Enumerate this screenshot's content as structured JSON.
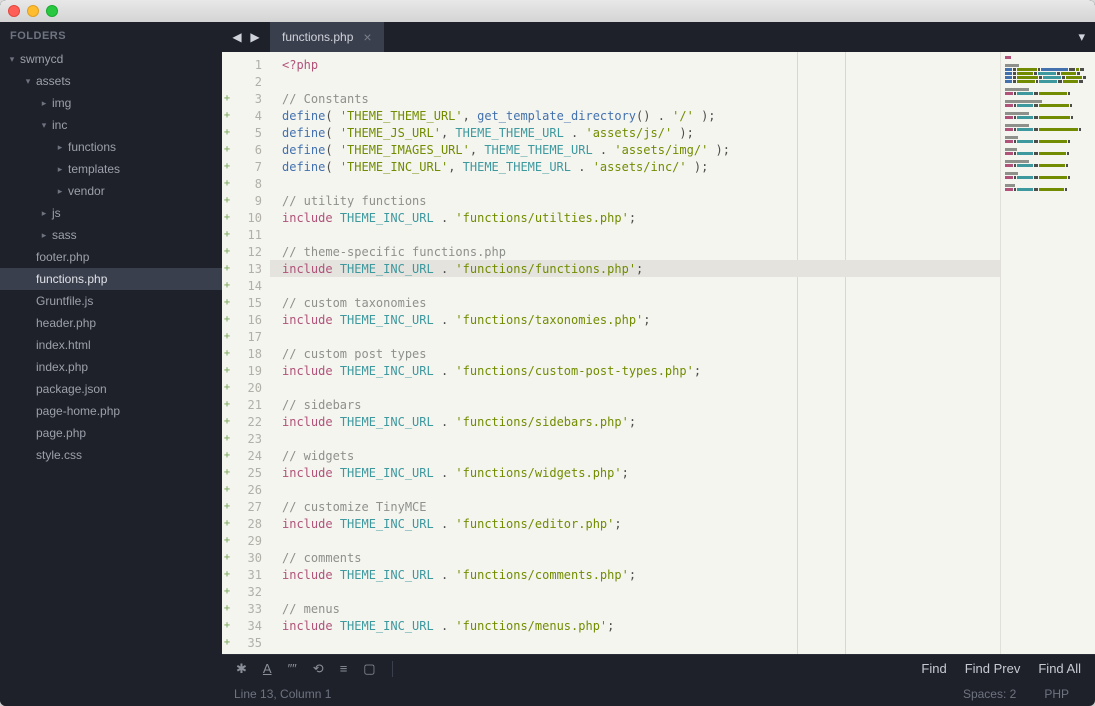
{
  "titlebar": {},
  "sidebar": {
    "header": "FOLDERS",
    "tree": [
      {
        "label": "swmycd",
        "depth": 0,
        "arrow": "down",
        "folder": true
      },
      {
        "label": "assets",
        "depth": 1,
        "arrow": "down",
        "folder": true
      },
      {
        "label": "img",
        "depth": 2,
        "arrow": "right",
        "folder": true
      },
      {
        "label": "inc",
        "depth": 2,
        "arrow": "down",
        "folder": true
      },
      {
        "label": "functions",
        "depth": 3,
        "arrow": "right",
        "folder": true
      },
      {
        "label": "templates",
        "depth": 3,
        "arrow": "right",
        "folder": true
      },
      {
        "label": "vendor",
        "depth": 3,
        "arrow": "right",
        "folder": true
      },
      {
        "label": "js",
        "depth": 2,
        "arrow": "right",
        "folder": true
      },
      {
        "label": "sass",
        "depth": 2,
        "arrow": "right",
        "folder": true
      },
      {
        "label": "footer.php",
        "depth": 1,
        "folder": false
      },
      {
        "label": "functions.php",
        "depth": 1,
        "folder": false,
        "active": true
      },
      {
        "label": "Gruntfile.js",
        "depth": 1,
        "folder": false
      },
      {
        "label": "header.php",
        "depth": 1,
        "folder": false
      },
      {
        "label": "index.html",
        "depth": 1,
        "folder": false
      },
      {
        "label": "index.php",
        "depth": 1,
        "folder": false
      },
      {
        "label": "package.json",
        "depth": 1,
        "folder": false
      },
      {
        "label": "page-home.php",
        "depth": 1,
        "folder": false
      },
      {
        "label": "page.php",
        "depth": 1,
        "folder": false
      },
      {
        "label": "style.css",
        "depth": 1,
        "folder": false
      }
    ]
  },
  "tabs": {
    "active": {
      "label": "functions.php"
    }
  },
  "code": {
    "lines": [
      {
        "n": 1,
        "plus": false,
        "selected": false,
        "tokens": [
          [
            "kw",
            "<?php"
          ]
        ]
      },
      {
        "n": 2,
        "plus": false,
        "selected": false,
        "tokens": []
      },
      {
        "n": 3,
        "plus": true,
        "selected": false,
        "tokens": [
          [
            "com",
            "// Constants"
          ]
        ]
      },
      {
        "n": 4,
        "plus": true,
        "selected": false,
        "tokens": [
          [
            "fn",
            "define"
          ],
          [
            "punc",
            "( "
          ],
          [
            "str",
            "'THEME_THEME_URL'"
          ],
          [
            "punc",
            ", "
          ],
          [
            "fn",
            "get_template_directory"
          ],
          [
            "punc",
            "() . "
          ],
          [
            "str",
            "'/'"
          ],
          [
            "punc",
            " );"
          ]
        ]
      },
      {
        "n": 5,
        "plus": true,
        "selected": false,
        "tokens": [
          [
            "fn",
            "define"
          ],
          [
            "punc",
            "( "
          ],
          [
            "str",
            "'THEME_JS_URL'"
          ],
          [
            "punc",
            ", "
          ],
          [
            "const",
            "THEME_THEME_URL"
          ],
          [
            "punc",
            " . "
          ],
          [
            "str",
            "'assets/js/'"
          ],
          [
            "punc",
            " );"
          ]
        ]
      },
      {
        "n": 6,
        "plus": true,
        "selected": false,
        "tokens": [
          [
            "fn",
            "define"
          ],
          [
            "punc",
            "( "
          ],
          [
            "str",
            "'THEME_IMAGES_URL'"
          ],
          [
            "punc",
            ", "
          ],
          [
            "const",
            "THEME_THEME_URL"
          ],
          [
            "punc",
            " . "
          ],
          [
            "str",
            "'assets/img/'"
          ],
          [
            "punc",
            " );"
          ]
        ]
      },
      {
        "n": 7,
        "plus": true,
        "selected": false,
        "tokens": [
          [
            "fn",
            "define"
          ],
          [
            "punc",
            "( "
          ],
          [
            "str",
            "'THEME_INC_URL'"
          ],
          [
            "punc",
            ", "
          ],
          [
            "const",
            "THEME_THEME_URL"
          ],
          [
            "punc",
            " . "
          ],
          [
            "str",
            "'assets/inc/'"
          ],
          [
            "punc",
            " );"
          ]
        ]
      },
      {
        "n": 8,
        "plus": true,
        "selected": false,
        "tokens": []
      },
      {
        "n": 9,
        "plus": true,
        "selected": false,
        "tokens": [
          [
            "com",
            "// utility functions"
          ]
        ]
      },
      {
        "n": 10,
        "plus": true,
        "selected": false,
        "tokens": [
          [
            "kw",
            "include"
          ],
          [
            "punc",
            " "
          ],
          [
            "const",
            "THEME_INC_URL"
          ],
          [
            "punc",
            " . "
          ],
          [
            "str",
            "'functions/utilties.php'"
          ],
          [
            "punc",
            ";"
          ]
        ]
      },
      {
        "n": 11,
        "plus": true,
        "selected": false,
        "tokens": []
      },
      {
        "n": 12,
        "plus": true,
        "selected": false,
        "tokens": [
          [
            "com",
            "// theme-specific functions.php"
          ]
        ]
      },
      {
        "n": 13,
        "plus": true,
        "selected": true,
        "tokens": [
          [
            "kw",
            "include"
          ],
          [
            "punc",
            " "
          ],
          [
            "const",
            "THEME_INC_URL"
          ],
          [
            "punc",
            " . "
          ],
          [
            "str",
            "'functions/functions.php'"
          ],
          [
            "punc",
            ";"
          ]
        ]
      },
      {
        "n": 14,
        "plus": true,
        "selected": false,
        "tokens": []
      },
      {
        "n": 15,
        "plus": true,
        "selected": false,
        "tokens": [
          [
            "com",
            "// custom taxonomies"
          ]
        ]
      },
      {
        "n": 16,
        "plus": true,
        "selected": false,
        "tokens": [
          [
            "kw",
            "include"
          ],
          [
            "punc",
            " "
          ],
          [
            "const",
            "THEME_INC_URL"
          ],
          [
            "punc",
            " . "
          ],
          [
            "str",
            "'functions/taxonomies.php'"
          ],
          [
            "punc",
            ";"
          ]
        ]
      },
      {
        "n": 17,
        "plus": true,
        "selected": false,
        "tokens": []
      },
      {
        "n": 18,
        "plus": true,
        "selected": false,
        "tokens": [
          [
            "com",
            "// custom post types"
          ]
        ]
      },
      {
        "n": 19,
        "plus": true,
        "selected": false,
        "tokens": [
          [
            "kw",
            "include"
          ],
          [
            "punc",
            " "
          ],
          [
            "const",
            "THEME_INC_URL"
          ],
          [
            "punc",
            " . "
          ],
          [
            "str",
            "'functions/custom-post-types.php'"
          ],
          [
            "punc",
            ";"
          ]
        ]
      },
      {
        "n": 20,
        "plus": true,
        "selected": false,
        "tokens": []
      },
      {
        "n": 21,
        "plus": true,
        "selected": false,
        "tokens": [
          [
            "com",
            "// sidebars"
          ]
        ]
      },
      {
        "n": 22,
        "plus": true,
        "selected": false,
        "tokens": [
          [
            "kw",
            "include"
          ],
          [
            "punc",
            " "
          ],
          [
            "const",
            "THEME_INC_URL"
          ],
          [
            "punc",
            " . "
          ],
          [
            "str",
            "'functions/sidebars.php'"
          ],
          [
            "punc",
            ";"
          ]
        ]
      },
      {
        "n": 23,
        "plus": true,
        "selected": false,
        "tokens": []
      },
      {
        "n": 24,
        "plus": true,
        "selected": false,
        "tokens": [
          [
            "com",
            "// widgets"
          ]
        ]
      },
      {
        "n": 25,
        "plus": true,
        "selected": false,
        "tokens": [
          [
            "kw",
            "include"
          ],
          [
            "punc",
            " "
          ],
          [
            "const",
            "THEME_INC_URL"
          ],
          [
            "punc",
            " . "
          ],
          [
            "str",
            "'functions/widgets.php'"
          ],
          [
            "punc",
            ";"
          ]
        ]
      },
      {
        "n": 26,
        "plus": true,
        "selected": false,
        "tokens": []
      },
      {
        "n": 27,
        "plus": true,
        "selected": false,
        "tokens": [
          [
            "com",
            "// customize TinyMCE"
          ]
        ]
      },
      {
        "n": 28,
        "plus": true,
        "selected": false,
        "tokens": [
          [
            "kw",
            "include"
          ],
          [
            "punc",
            " "
          ],
          [
            "const",
            "THEME_INC_URL"
          ],
          [
            "punc",
            " . "
          ],
          [
            "str",
            "'functions/editor.php'"
          ],
          [
            "punc",
            ";"
          ]
        ]
      },
      {
        "n": 29,
        "plus": true,
        "selected": false,
        "tokens": []
      },
      {
        "n": 30,
        "plus": true,
        "selected": false,
        "tokens": [
          [
            "com",
            "// comments"
          ]
        ]
      },
      {
        "n": 31,
        "plus": true,
        "selected": false,
        "tokens": [
          [
            "kw",
            "include"
          ],
          [
            "punc",
            " "
          ],
          [
            "const",
            "THEME_INC_URL"
          ],
          [
            "punc",
            " . "
          ],
          [
            "str",
            "'functions/comments.php'"
          ],
          [
            "punc",
            ";"
          ]
        ]
      },
      {
        "n": 32,
        "plus": true,
        "selected": false,
        "tokens": []
      },
      {
        "n": 33,
        "plus": true,
        "selected": false,
        "tokens": [
          [
            "com",
            "// menus"
          ]
        ]
      },
      {
        "n": 34,
        "plus": true,
        "selected": false,
        "tokens": [
          [
            "kw",
            "include"
          ],
          [
            "punc",
            " "
          ],
          [
            "const",
            "THEME_INC_URL"
          ],
          [
            "punc",
            " . "
          ],
          [
            "str",
            "'functions/menus.php'"
          ],
          [
            "punc",
            ";"
          ]
        ]
      },
      {
        "n": 35,
        "plus": true,
        "selected": false,
        "tokens": []
      }
    ]
  },
  "findbar": {
    "find": "Find",
    "findPrev": "Find Prev",
    "findAll": "Find All"
  },
  "statusbar": {
    "position": "Line 13, Column 1",
    "spaces": "Spaces: 2",
    "lang": "PHP"
  }
}
